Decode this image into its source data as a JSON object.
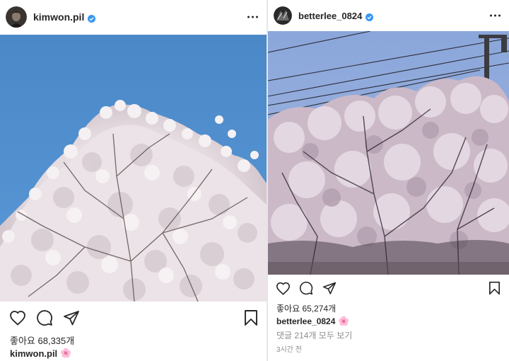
{
  "posts": [
    {
      "username": "kimwon.pil",
      "likes": "좋아요 68,335개",
      "caption_user": "kimwon.pil",
      "caption_emoji": "🌸",
      "photo_sky_color": "#4f8fcf"
    },
    {
      "username": "betterlee_0824",
      "likes": "좋아요 65,274개",
      "caption_user": "betterlee_0824",
      "caption_emoji": "🌸",
      "comments_link": "댓글 214개 모두 보기",
      "time": "3시간 전",
      "photo_sky_color": "#8fa9d8"
    }
  ],
  "icons": {
    "verified": "verified-badge-icon",
    "more": "more-options-icon",
    "like": "heart-icon",
    "comment": "comment-icon",
    "share": "paper-plane-icon",
    "save": "bookmark-icon"
  },
  "colors": {
    "verified_blue": "#3897f0",
    "text": "#262626",
    "muted": "#8e8e8e"
  }
}
